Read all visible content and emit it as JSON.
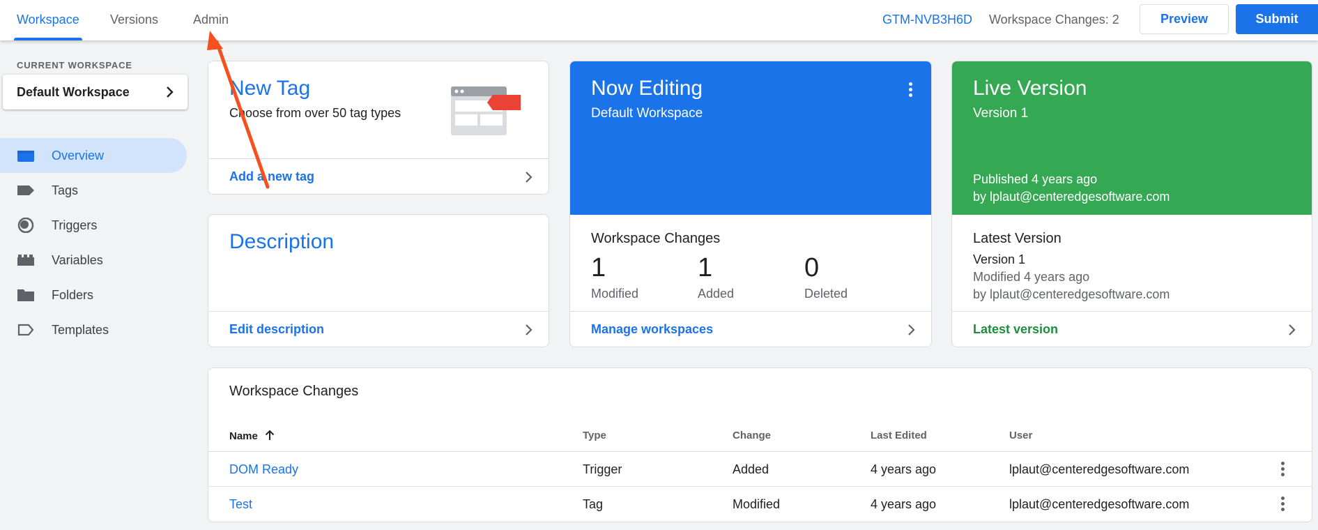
{
  "topbar": {
    "tabs": [
      {
        "label": "Workspace",
        "active": true
      },
      {
        "label": "Versions",
        "active": false
      },
      {
        "label": "Admin",
        "active": false
      }
    ],
    "container_id": "GTM-NVB3H6D",
    "workspace_changes": "Workspace Changes: 2",
    "preview_label": "Preview",
    "submit_label": "Submit"
  },
  "sidebar": {
    "current_workspace_label": "CURRENT WORKSPACE",
    "current_workspace": "Default Workspace",
    "items": [
      {
        "label": "Overview",
        "icon": "overview-icon",
        "active": true
      },
      {
        "label": "Tags",
        "icon": "tag-icon",
        "active": false
      },
      {
        "label": "Triggers",
        "icon": "trigger-icon",
        "active": false
      },
      {
        "label": "Variables",
        "icon": "variables-icon",
        "active": false
      },
      {
        "label": "Folders",
        "icon": "folder-icon",
        "active": false
      },
      {
        "label": "Templates",
        "icon": "template-icon",
        "active": false
      }
    ]
  },
  "new_tag_card": {
    "title": "New Tag",
    "subtitle": "Choose from over 50 tag types",
    "footer": "Add a new tag"
  },
  "description_card": {
    "title": "Description",
    "footer": "Edit description"
  },
  "now_editing_card": {
    "title": "Now Editing",
    "subtitle": "Default Workspace",
    "changes_title": "Workspace Changes",
    "stats": [
      {
        "value": "1",
        "label": "Modified"
      },
      {
        "value": "1",
        "label": "Added"
      },
      {
        "value": "0",
        "label": "Deleted"
      }
    ],
    "footer": "Manage workspaces",
    "color": "#1a73e8"
  },
  "live_version_card": {
    "title": "Live Version",
    "subtitle": "Version 1",
    "published": "Published 4 years ago",
    "published_by": "by lplaut@centeredgesoftware.com",
    "latest_title": "Latest Version",
    "latest_version": "Version 1",
    "modified": "Modified 4 years ago",
    "modified_by": "by lplaut@centeredgesoftware.com",
    "footer": "Latest version",
    "color": "#34a853"
  },
  "changes_table": {
    "title": "Workspace Changes",
    "columns": [
      "Name",
      "Type",
      "Change",
      "Last Edited",
      "User"
    ],
    "rows": [
      {
        "name": "DOM Ready",
        "type": "Trigger",
        "change": "Added",
        "last_edited": "4 years ago",
        "user": "lplaut@centeredgesoftware.com"
      },
      {
        "name": "Test",
        "type": "Tag",
        "change": "Modified",
        "last_edited": "4 years ago",
        "user": "lplaut@centeredgesoftware.com"
      }
    ]
  }
}
